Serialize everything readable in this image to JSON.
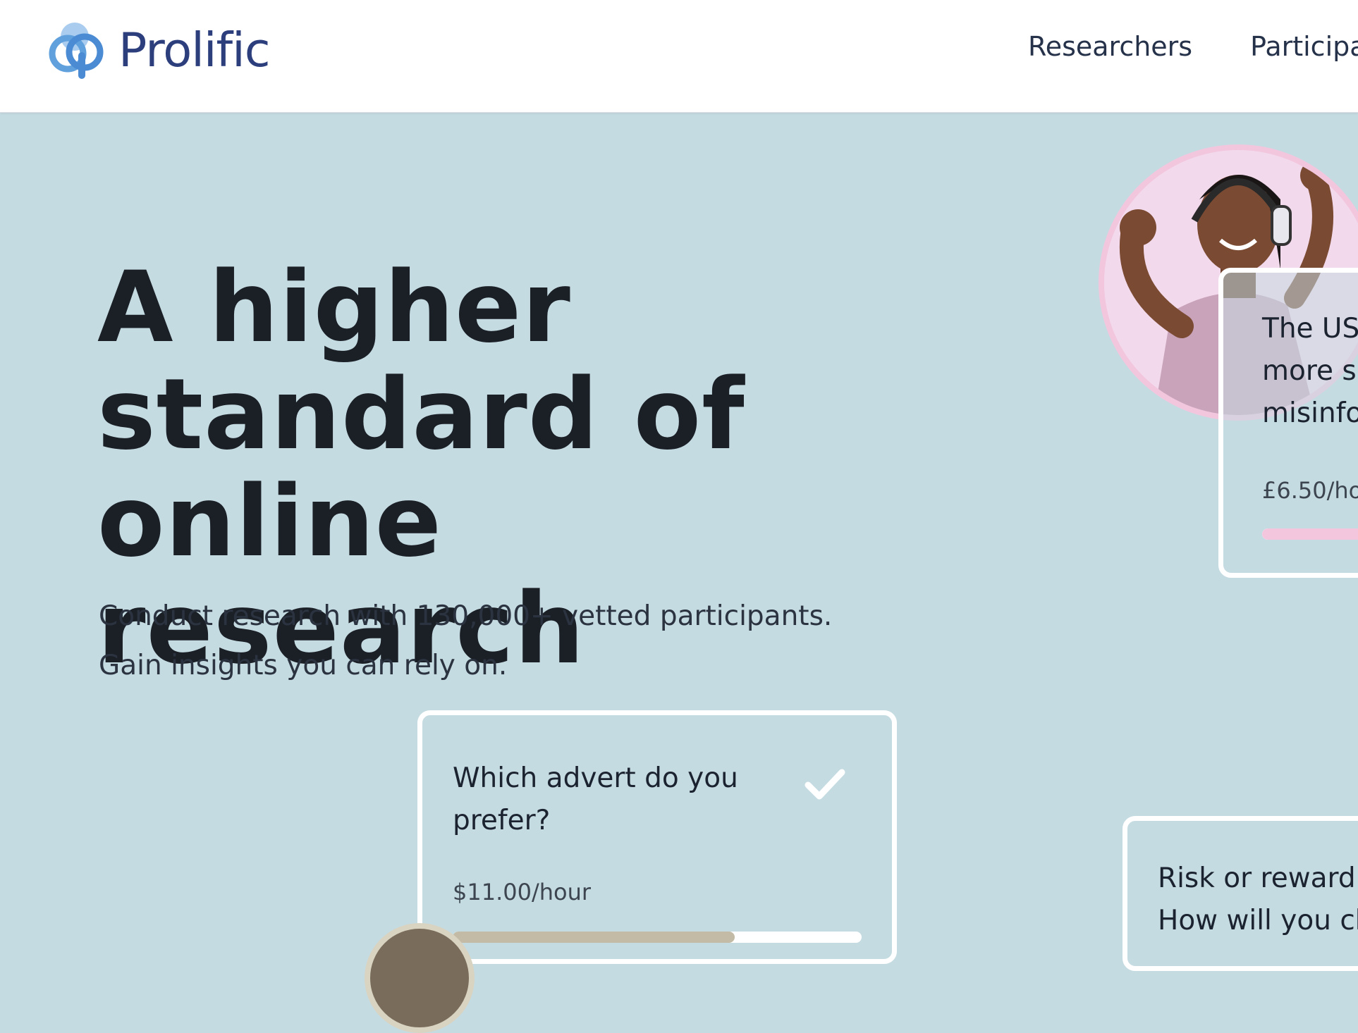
{
  "header": {
    "logo_text": "Prolific",
    "nav": [
      {
        "label": "Researchers"
      },
      {
        "label": "Participants"
      }
    ]
  },
  "hero": {
    "title_lines": [
      "A higher",
      "standard of",
      "online research"
    ],
    "subtitle_lines": [
      "Conduct research with 130,000+ vetted participants.",
      "Gain insights you can rely on."
    ]
  },
  "cards": [
    {
      "question": "Which advert do you prefer?",
      "rate": "$11.00/hour",
      "progress": 0.69,
      "bar_color": "#c4bba6",
      "check_icon": "check-icon"
    },
    {
      "question_lines": [
        "The US",
        "more s",
        "misinfo"
      ],
      "rate": "£6.50/ho",
      "progress": 1.0,
      "bar_color": "#f4c6de"
    },
    {
      "question_lines": [
        "Risk or reward:",
        "How will you ch"
      ]
    }
  ],
  "colors": {
    "background": "#c5dbe2",
    "brand": "#2c3e7c",
    "logo_light": "#5fa0dd",
    "card_border": "#ffffff"
  }
}
